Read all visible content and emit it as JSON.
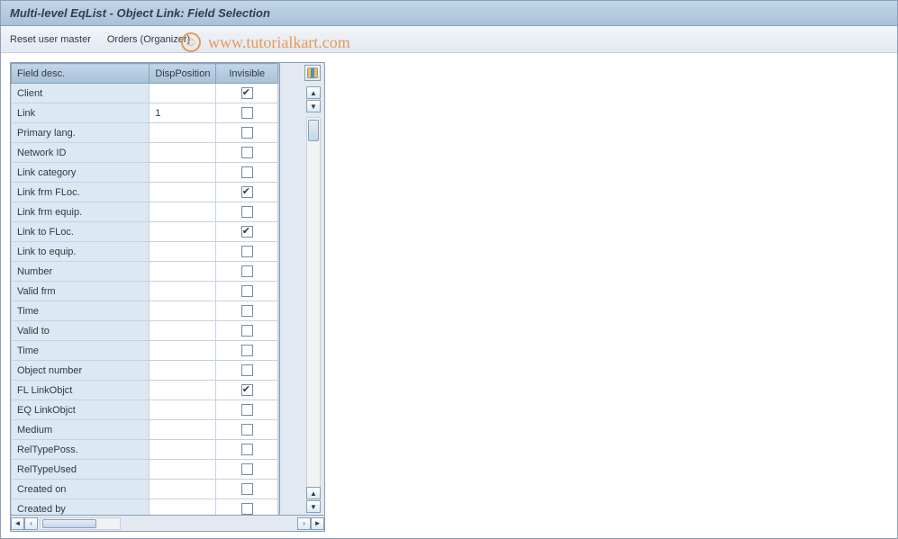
{
  "title": "Multi-level EqList - Object Link: Field Selection",
  "toolbar": {
    "reset": "Reset user master",
    "orders": "Orders (Organizer)"
  },
  "columns": {
    "desc": "Field desc.",
    "pos": "DispPosition",
    "inv": "Invisible"
  },
  "rows": [
    {
      "desc": "Client",
      "pos": "",
      "inv": true
    },
    {
      "desc": "Link",
      "pos": "1",
      "inv": false
    },
    {
      "desc": "Primary lang.",
      "pos": "",
      "inv": false
    },
    {
      "desc": "Network ID",
      "pos": "",
      "inv": false
    },
    {
      "desc": "Link category",
      "pos": "",
      "inv": false
    },
    {
      "desc": "Link frm FLoc.",
      "pos": "",
      "inv": true
    },
    {
      "desc": "Link frm equip.",
      "pos": "",
      "inv": false
    },
    {
      "desc": "Link to FLoc.",
      "pos": "",
      "inv": true
    },
    {
      "desc": "Link to equip.",
      "pos": "",
      "inv": false
    },
    {
      "desc": "Number",
      "pos": "",
      "inv": false
    },
    {
      "desc": "Valid frm",
      "pos": "",
      "inv": false
    },
    {
      "desc": "Time",
      "pos": "",
      "inv": false
    },
    {
      "desc": "Valid to",
      "pos": "",
      "inv": false
    },
    {
      "desc": "Time",
      "pos": "",
      "inv": false
    },
    {
      "desc": "Object number",
      "pos": "",
      "inv": false
    },
    {
      "desc": "FL LinkObjct",
      "pos": "",
      "inv": true
    },
    {
      "desc": "EQ LinkObjct",
      "pos": "",
      "inv": false
    },
    {
      "desc": "Medium",
      "pos": "",
      "inv": false
    },
    {
      "desc": "RelTypePoss.",
      "pos": "",
      "inv": false
    },
    {
      "desc": "RelTypeUsed",
      "pos": "",
      "inv": false
    },
    {
      "desc": "Created on",
      "pos": "",
      "inv": false
    },
    {
      "desc": "Created by",
      "pos": "",
      "inv": false
    }
  ],
  "watermark": {
    "copy": "©",
    "text": "www.tutorialkart.com"
  }
}
